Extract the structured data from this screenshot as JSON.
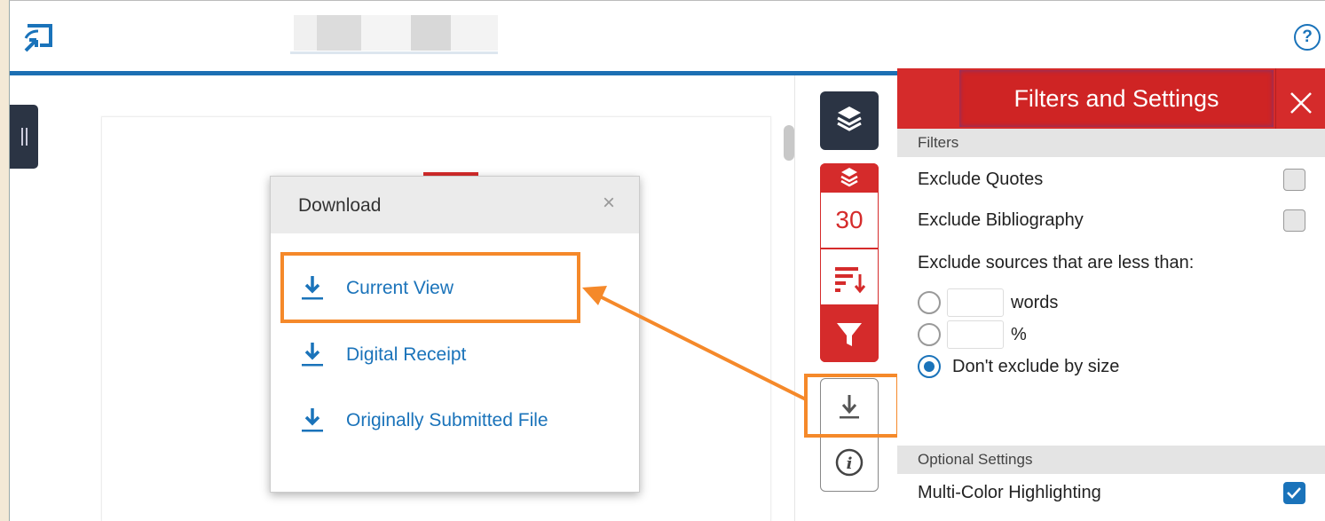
{
  "toolbar": {
    "score": "30"
  },
  "download_popup": {
    "title": "Download",
    "close_glyph": "×",
    "items": [
      {
        "label": "Current View",
        "icon": "download-icon"
      },
      {
        "label": "Digital Receipt",
        "icon": "download-icon"
      },
      {
        "label": "Originally Submitted File",
        "icon": "download-icon"
      }
    ]
  },
  "filters_panel": {
    "title": "Filters and Settings",
    "filters_header": "Filters",
    "exclude_quotes": "Exclude Quotes",
    "exclude_bibliography": "Exclude Bibliography",
    "exclude_sources_label": "Exclude sources that are less than:",
    "words_unit": "words",
    "percent_unit": "%",
    "dont_exclude": "Don't exclude by size",
    "optional_header": "Optional Settings",
    "multi_color": "Multi-Color Highlighting"
  },
  "colors": {
    "accent_red": "#d52b2b",
    "link_blue": "#1a73ba",
    "highlight_orange": "#f5892a",
    "dark_navy": "#2b3444"
  }
}
